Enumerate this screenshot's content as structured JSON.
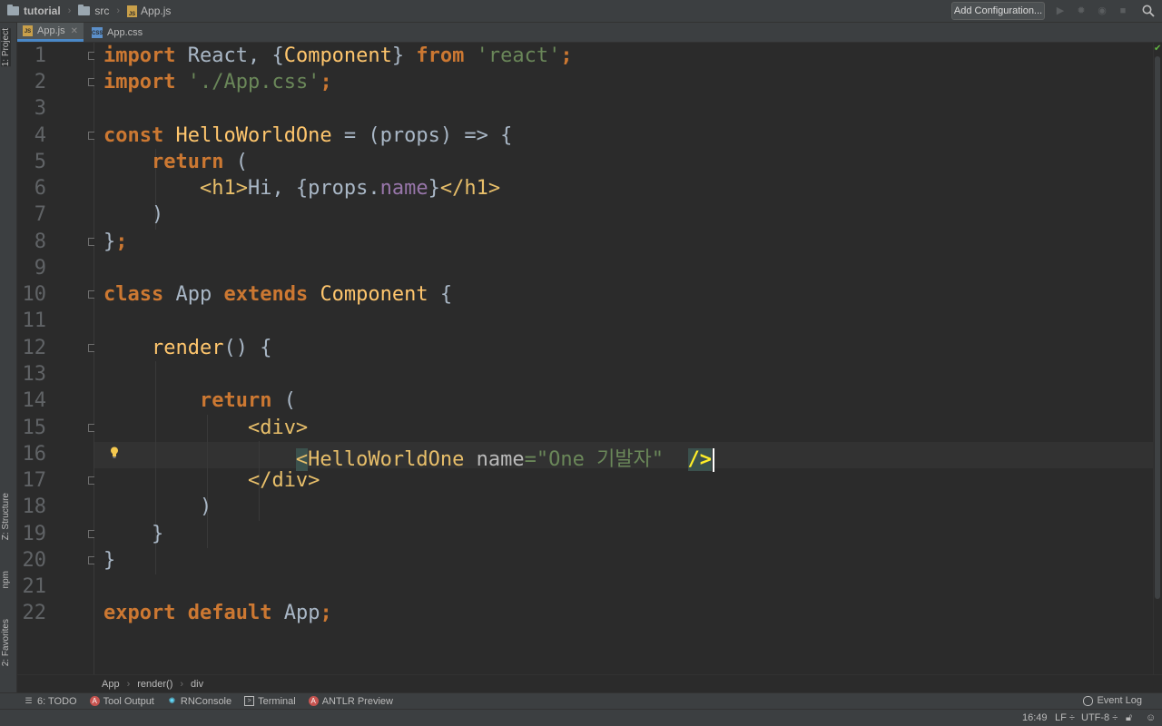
{
  "nav": {
    "crumbs": [
      "tutorial",
      "src",
      "App.js"
    ],
    "add_config": "Add Configuration..."
  },
  "tabs": [
    {
      "label": "App.js",
      "icon": "js-file-icon",
      "active": true
    },
    {
      "label": "App.css",
      "icon": "css-file-icon",
      "active": false
    }
  ],
  "left_tools": [
    "1: Project",
    "Z: Structure",
    "npm",
    "2: Favorites"
  ],
  "editor": {
    "line_numbers": [
      "1",
      "2",
      "3",
      "4",
      "5",
      "6",
      "7",
      "8",
      "9",
      "10",
      "11",
      "12",
      "13",
      "14",
      "15",
      "16",
      "17",
      "18",
      "19",
      "20",
      "21",
      "22"
    ],
    "current_line": 16
  },
  "code": {
    "l1": {
      "k1": "import",
      "t1": " React, {",
      "c1": "Component",
      "t2": "} ",
      "k2": "from",
      "sp": " ",
      "s1": "'react'",
      "sc": ";"
    },
    "l2": {
      "k1": "import",
      "sp": " ",
      "s1": "'./App.css'",
      "sc": ";"
    },
    "l4": {
      "k1": "const",
      "sp": " ",
      "f1": "HelloWorldOne",
      "t1": " = (props) => {"
    },
    "l5": {
      "ind": "    ",
      "k1": "return",
      "t1": " ("
    },
    "l6": {
      "ind": "        ",
      "g1": "<h1>",
      "t1": "Hi, {props.",
      "p1": "name",
      "t2": "}",
      "g2": "</h1>"
    },
    "l7": {
      "ind": "    ",
      "t1": ")"
    },
    "l8": {
      "t1": "}",
      "sc": ";"
    },
    "l10": {
      "k1": "class",
      "t1": " App ",
      "k2": "extends",
      "sp": " ",
      "f1": "Component",
      "t2": " {"
    },
    "l12": {
      "ind": "    ",
      "f1": "render",
      "t1": "() {"
    },
    "l14": {
      "ind": "        ",
      "k1": "return",
      "t1": " ("
    },
    "l15": {
      "ind": "            ",
      "g1": "<div>"
    },
    "l16": {
      "ind": "                ",
      "g0": "<",
      "g1": "HelloWorldOne",
      "sp": " ",
      "a1": "name",
      "eq": "=",
      "s1": "\"One 기발자\"",
      "sp2": "  ",
      "g2": "/>"
    },
    "l17": {
      "ind": "            ",
      "g1": "</div>"
    },
    "l18": {
      "ind": "        ",
      "t1": ")"
    },
    "l19": {
      "ind": "    ",
      "t1": "}"
    },
    "l20": {
      "t1": "}"
    },
    "l22": {
      "k1": "export",
      "sp": " ",
      "k2": "default",
      "t1": " App",
      "sc": ";"
    }
  },
  "breadcrumb": [
    "App",
    "render()",
    "div"
  ],
  "bottom_tools": [
    {
      "label": "6: TODO",
      "icon": "todo-icon"
    },
    {
      "label": "Tool Output",
      "icon": "tool-output-icon"
    },
    {
      "label": "RNConsole",
      "icon": "react-icon"
    },
    {
      "label": "Terminal",
      "icon": "terminal-icon"
    },
    {
      "label": "ANTLR Preview",
      "icon": "antlr-icon"
    }
  ],
  "event_log": "Event Log",
  "status": {
    "position": "16:49",
    "line_sep": "LF ÷",
    "encoding": "UTF-8 ÷"
  },
  "colors": {
    "keyword": "#cc7832",
    "string": "#6a8759",
    "function": "#ffc66d",
    "tag": "#e8bf6a",
    "property": "#9876aa",
    "default": "#a9b7c6",
    "background": "#2b2b2b"
  }
}
